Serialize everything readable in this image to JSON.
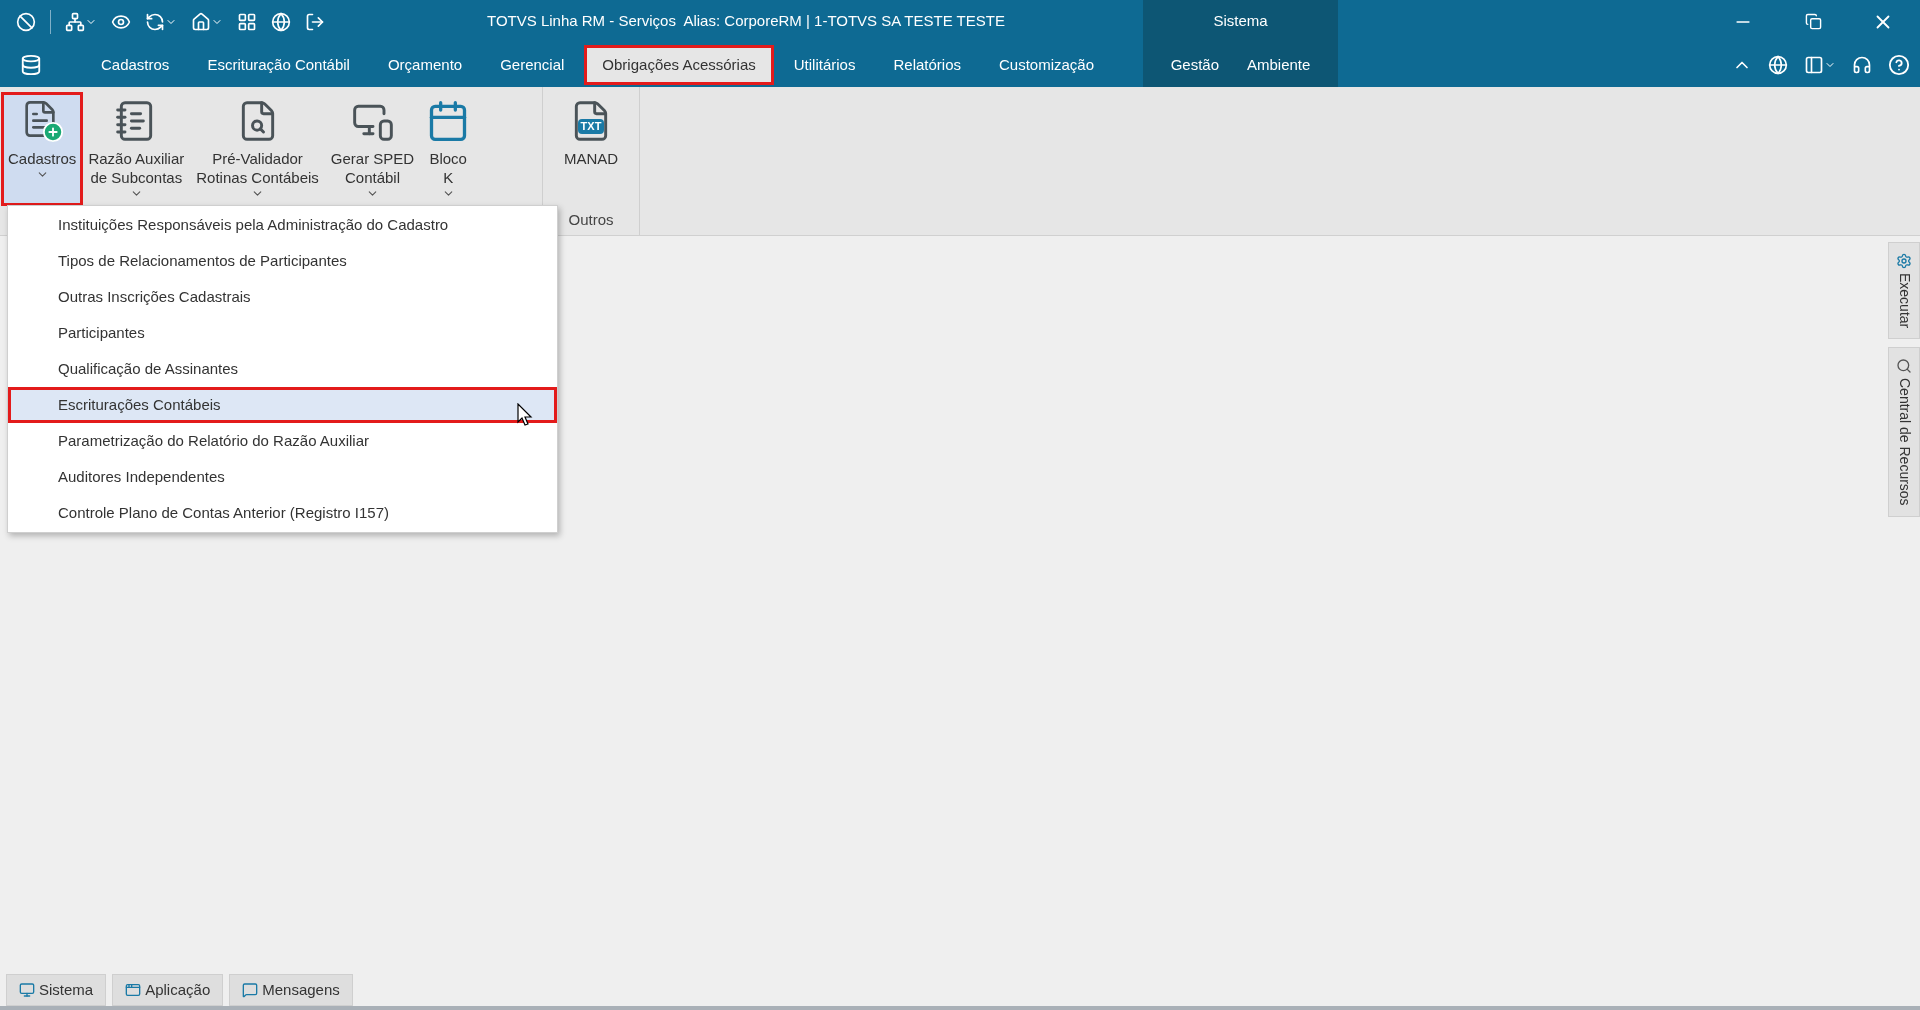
{
  "window": {
    "title": "TOTVS Linha RM - Serviços  Alias: CorporeRM | 1-TOTVS SA TESTE TESTE"
  },
  "tabs": [
    {
      "label": "Cadastros",
      "selected": false,
      "highlighted": false
    },
    {
      "label": "Escrituração Contábil",
      "selected": false,
      "highlighted": false
    },
    {
      "label": "Orçamento",
      "selected": false,
      "highlighted": false
    },
    {
      "label": "Gerencial",
      "selected": false,
      "highlighted": false
    },
    {
      "label": "Obrigações Acessórias",
      "selected": true,
      "highlighted": true
    },
    {
      "label": "Utilitários",
      "selected": false,
      "highlighted": false
    },
    {
      "label": "Relatórios",
      "selected": false,
      "highlighted": false
    },
    {
      "label": "Customização",
      "selected": false,
      "highlighted": false
    }
  ],
  "context_group": {
    "title": "Sistema",
    "tabs": [
      {
        "label": "Gestão",
        "selected": false
      },
      {
        "label": "Ambiente",
        "selected": false
      }
    ]
  },
  "ribbon": {
    "groups": [
      {
        "buttons": [
          {
            "kind": "cadastros",
            "label": "Cadastros",
            "dropdown": true,
            "pressed": true,
            "highlighted": true
          },
          {
            "kind": "book",
            "label": "Razão Auxiliar\nde Subcontas",
            "dropdown": true,
            "pressed": false,
            "highlighted": false
          },
          {
            "kind": "search",
            "label": "Pré-Validador\nRotinas Contábeis",
            "dropdown": true,
            "pressed": false,
            "highlighted": false
          },
          {
            "kind": "devices",
            "label": "Gerar SPED\nContábil",
            "dropdown": true,
            "pressed": false,
            "highlighted": false
          },
          {
            "kind": "calendar",
            "label": "Bloco\nK",
            "dropdown": true,
            "pressed": false,
            "highlighted": false
          }
        ]
      },
      {
        "label": "Outros",
        "buttons": [
          {
            "kind": "txt",
            "badge": "TXT",
            "label": "MANAD",
            "dropdown": false,
            "pressed": false,
            "highlighted": false
          }
        ]
      }
    ]
  },
  "dropdown_menu": {
    "items": [
      {
        "label": "Instituições Responsáveis pela Administração do Cadastro",
        "selected": false,
        "highlighted": false
      },
      {
        "label": "Tipos de Relacionamentos de Participantes",
        "selected": false,
        "highlighted": false
      },
      {
        "label": "Outras Inscrições Cadastrais",
        "selected": false,
        "highlighted": false
      },
      {
        "label": "Participantes",
        "selected": false,
        "highlighted": false
      },
      {
        "label": "Qualificação de Assinantes",
        "selected": false,
        "highlighted": false
      },
      {
        "label": "Escriturações Contábeis",
        "selected": true,
        "highlighted": true
      },
      {
        "label": "Parametrização do Relatório do Razão Auxiliar",
        "selected": false,
        "highlighted": false
      },
      {
        "label": "Auditores Independentes",
        "selected": false,
        "highlighted": false
      },
      {
        "label": "Controle Plano de Contas Anterior (Registro I157)",
        "selected": false,
        "highlighted": false
      }
    ]
  },
  "side_panel": [
    {
      "kind": "gear",
      "label": "Executar"
    },
    {
      "kind": "search",
      "label": "Central de Recursos"
    }
  ],
  "bottom_tabs": [
    {
      "kind": "monitor",
      "label": "Sistema"
    },
    {
      "kind": "app",
      "label": "Aplicação"
    },
    {
      "kind": "message",
      "label": "Mensagens"
    }
  ]
}
